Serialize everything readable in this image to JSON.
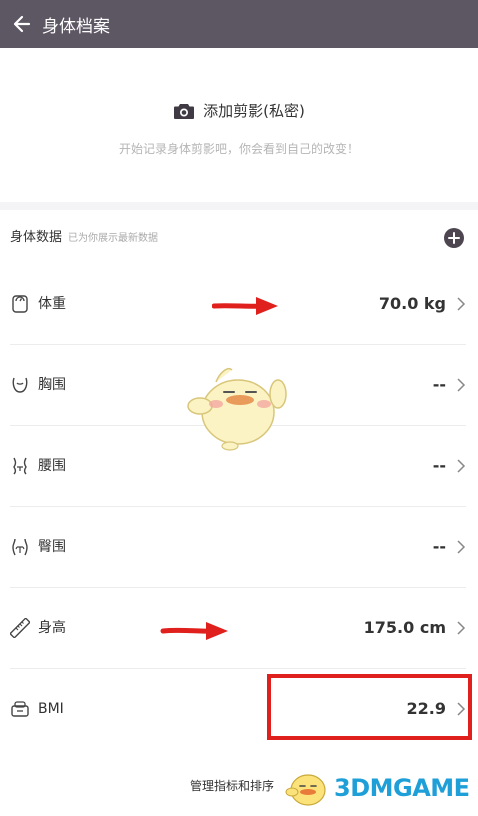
{
  "header": {
    "title": "身体档案"
  },
  "photo": {
    "add_label": "添加剪影(私密)",
    "hint": "开始记录身体剪影吧，你会看到自己的改变！"
  },
  "section": {
    "title": "身体数据",
    "subtitle": "已为你展示最新数据"
  },
  "metrics": [
    {
      "label": "体重",
      "value": "70.0 kg",
      "icon": "scale-icon"
    },
    {
      "label": "胸围",
      "value": "--",
      "icon": "chest-icon"
    },
    {
      "label": "腰围",
      "value": "--",
      "icon": "waist-icon"
    },
    {
      "label": "臀围",
      "value": "--",
      "icon": "hip-icon"
    },
    {
      "label": "身高",
      "value": "175.0 cm",
      "icon": "ruler-icon"
    },
    {
      "label": "BMI",
      "value": "22.9",
      "icon": "bmi-scale-icon"
    }
  ],
  "footer": {
    "manage_label": "管理指标和排序"
  },
  "watermark": {
    "text": "3DMGAME"
  },
  "colors": {
    "topbar": "#5d5663",
    "annotation_red": "#e0201c",
    "watermark_blue": "#1f9fd8"
  }
}
